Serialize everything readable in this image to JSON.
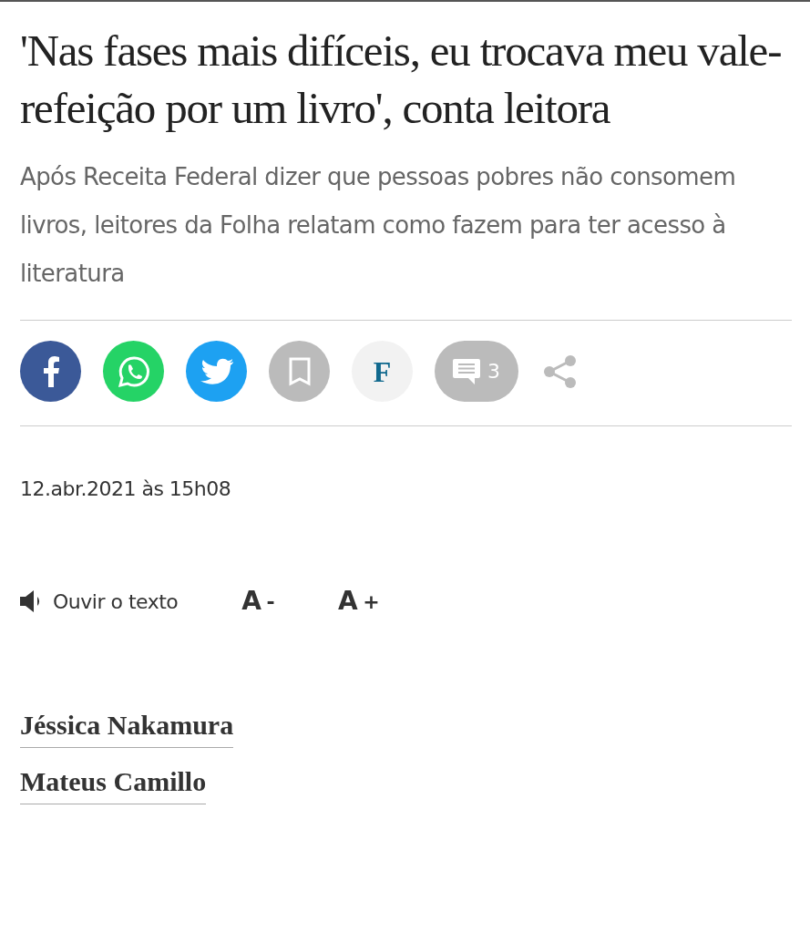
{
  "headline": "'Nas fases mais difíceis, eu trocava meu vale-refeição por um livro', conta leitora",
  "subtitle": "Após Receita Federal dizer que pessoas pobres não consomem livros, leitores da Folha relatam como fazem para ter acesso à literatura",
  "share_buttons": [
    {
      "kind": "facebook"
    },
    {
      "kind": "whatsapp"
    },
    {
      "kind": "twitter"
    },
    {
      "kind": "bookmark"
    },
    {
      "kind": "folha",
      "label": "F"
    },
    {
      "kind": "comments",
      "count": "3"
    },
    {
      "kind": "share"
    }
  ],
  "date": "12.abr.2021 às 15h08",
  "tools": {
    "listen": "Ouvir o texto",
    "font_smaller": {
      "letter": "A",
      "sign": "-"
    },
    "font_larger": {
      "letter": "A",
      "sign": "+"
    }
  },
  "authors": [
    "Jéssica Nakamura",
    "Mateus Camillo"
  ]
}
